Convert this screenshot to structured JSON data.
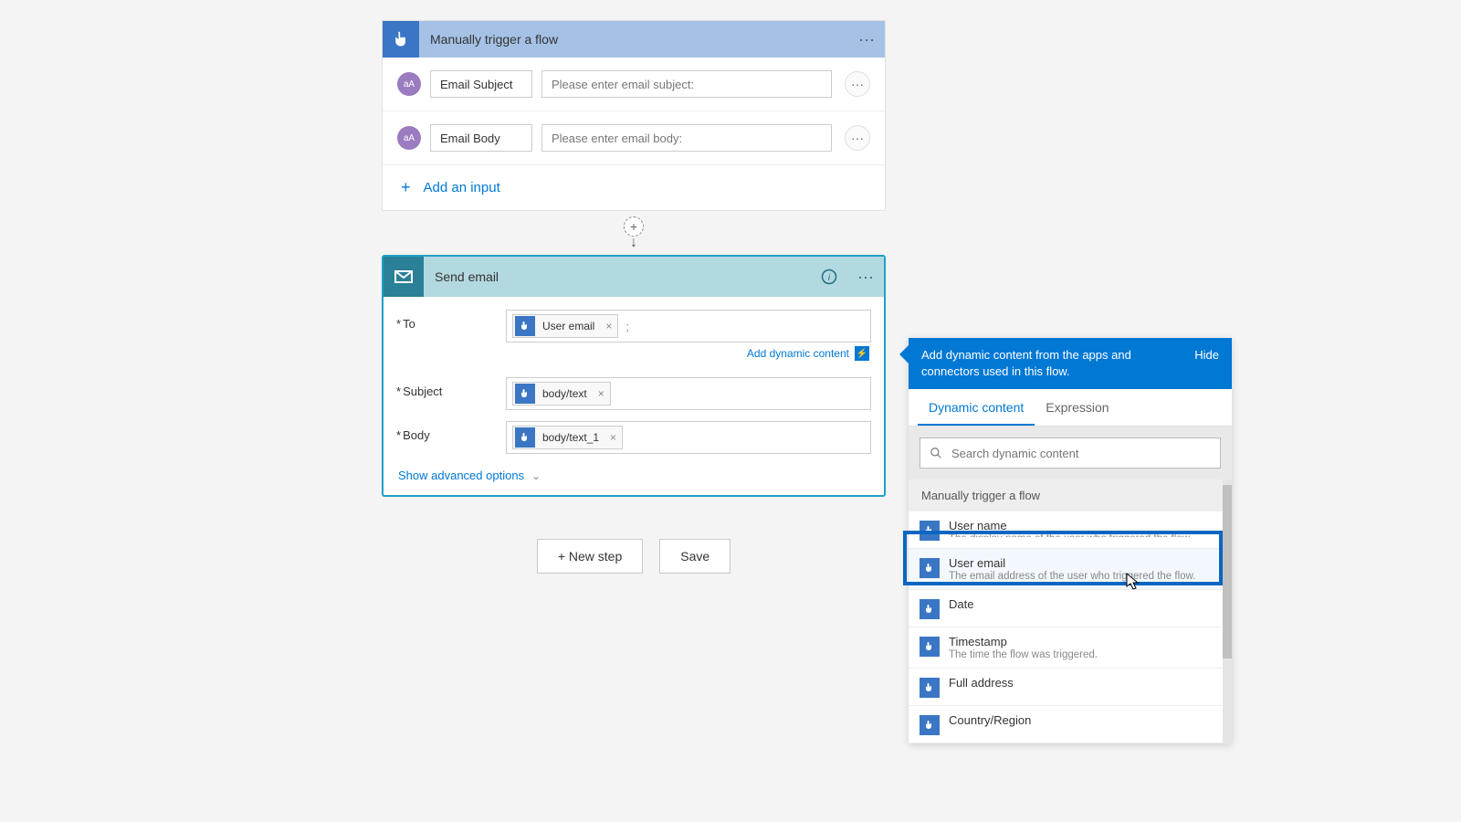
{
  "trigger": {
    "title": "Manually trigger a flow",
    "inputs": [
      {
        "icon": "aA",
        "name": "Email Subject",
        "placeholder": "Please enter email subject:"
      },
      {
        "icon": "aA",
        "name": "Email Body",
        "placeholder": "Please enter email body:"
      }
    ],
    "add_input": "Add an input"
  },
  "action": {
    "title": "Send email",
    "fields": {
      "to_label": "To",
      "subject_label": "Subject",
      "body_label": "Body"
    },
    "tokens": {
      "to": "User email",
      "subject": "body/text",
      "body": "body/text_1"
    },
    "to_suffix": ";",
    "add_dynamic": "Add dynamic content",
    "advanced": "Show advanced options"
  },
  "buttons": {
    "new_step": "+ New step",
    "save": "Save"
  },
  "flyout": {
    "message": "Add dynamic content from the apps and connectors used in this flow.",
    "hide": "Hide",
    "tab_dynamic": "Dynamic content",
    "tab_expression": "Expression",
    "search_placeholder": "Search dynamic content",
    "section": "Manually trigger a flow",
    "items": [
      {
        "title": "User name",
        "desc": "The display name of the user who triggered the flow"
      },
      {
        "title": "User email",
        "desc": "The email address of the user who triggered the flow."
      },
      {
        "title": "Date",
        "desc": ""
      },
      {
        "title": "Timestamp",
        "desc": "The time the flow was triggered."
      },
      {
        "title": "Full address",
        "desc": ""
      },
      {
        "title": "Country/Region",
        "desc": ""
      }
    ]
  }
}
